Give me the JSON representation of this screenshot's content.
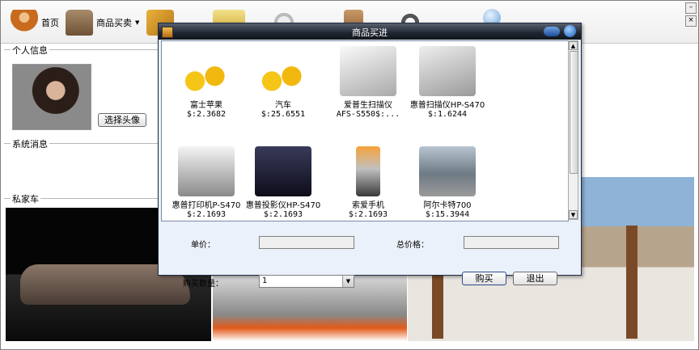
{
  "nav": {
    "items": [
      {
        "label": "首页",
        "icon": "person-icon",
        "color": "#c86b1f"
      },
      {
        "label": "商品买卖",
        "icon": "handbag-icon",
        "color": "#8a6a48"
      },
      {
        "label": "",
        "icon": "book-icon",
        "color": "#c48a1a"
      },
      {
        "label": "",
        "icon": "money-icon",
        "color": "#d6b23a"
      },
      {
        "label": "",
        "icon": "coins-icon",
        "color": "#c9c9c9"
      },
      {
        "label": "",
        "icon": "box-icon",
        "color": "#a87a4a"
      },
      {
        "label": "",
        "icon": "cow-icon",
        "color": "#9a9a9a"
      },
      {
        "label": "",
        "icon": "search-globe-icon",
        "color": "#6aa0d8"
      }
    ],
    "dropdown_arrow": "▼"
  },
  "personal_info": {
    "title": "个人信息",
    "select_avatar_label": "选择头像"
  },
  "system_messages": {
    "title": "系统消息"
  },
  "private_car": {
    "title": "私家车"
  },
  "dialog": {
    "title": "商品买进",
    "products": [
      {
        "name": "富士苹果",
        "price": "$:2.3682",
        "icon": "gold-coins-icon"
      },
      {
        "name": "汽车",
        "price": "$:25.6551",
        "icon": "gold-coins-icon"
      },
      {
        "name": "爱普生扫描仪",
        "price": "AFS-S550$:...",
        "icon": "scanner-icon"
      },
      {
        "name": "惠普扫描仪HP-S470",
        "price": "$:1.6244",
        "icon": "flatbed-scanner-icon"
      },
      {
        "name": "惠普打印机P-S470",
        "price": "$:2.1693",
        "icon": "printer-icon"
      },
      {
        "name": "惠普投影仪HP-S470",
        "price": "$:2.1693",
        "icon": "projector-icon"
      },
      {
        "name": "索爱手机",
        "price": "$:2.1693",
        "icon": "mobile-phone-icon"
      },
      {
        "name": "阿尔卡特700",
        "price": "$:15.3944",
        "icon": "car-photo-icon"
      }
    ],
    "unit_price_label": "单价：",
    "unit_price_value": "",
    "total_price_label": "总价格：",
    "total_price_value": "",
    "quantity_label": "购买数量：",
    "quantity_value": "1",
    "buy_label": "购买",
    "exit_label": "退出"
  }
}
